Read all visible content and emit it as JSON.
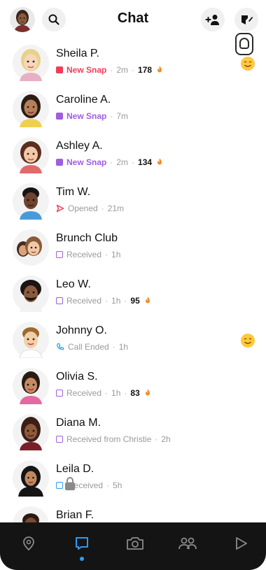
{
  "header": {
    "title": "Chat",
    "icons": [
      "bitmoji-avatar",
      "search-icon",
      "add-friend-icon",
      "new-chat-icon"
    ]
  },
  "colors": {
    "new_snap_red": "#f23c57",
    "new_snap_purple": "#a05ddf",
    "chat_blue": "#2ba0f0",
    "nav_bg": "#141414",
    "active_blue": "#2f9bf0"
  },
  "chats": [
    {
      "name": "Sheila P.",
      "status": "New Snap",
      "time": "2m",
      "streak": "178",
      "icon": "new-snap-red",
      "emoji": true
    },
    {
      "name": "Caroline A.",
      "status": "New Snap",
      "time": "7m",
      "streak": "",
      "icon": "new-snap-purple",
      "emoji": false
    },
    {
      "name": "Ashley A.",
      "status": "New Snap",
      "time": "2m",
      "streak": "134",
      "icon": "new-snap-purple",
      "emoji": false
    },
    {
      "name": "Tim W.",
      "status": "Opened",
      "time": "21m",
      "streak": "",
      "icon": "opened-red",
      "emoji": false
    },
    {
      "name": "Brunch Club",
      "status": "Received",
      "time": "1h",
      "streak": "",
      "icon": "received-purple",
      "emoji": false
    },
    {
      "name": "Leo W.",
      "status": "Received",
      "time": "1h",
      "streak": "95",
      "icon": "received-purple",
      "emoji": false
    },
    {
      "name": "Johnny O.",
      "status": "Call Ended",
      "time": "1h",
      "streak": "",
      "icon": "call-blue",
      "emoji": true
    },
    {
      "name": "Olivia S.",
      "status": "Received",
      "time": "1h",
      "streak": "83",
      "icon": "received-purple",
      "emoji": false
    },
    {
      "name": "Diana M.",
      "status": "Received from Christie",
      "time": "2h",
      "streak": "",
      "icon": "received-purple",
      "emoji": false
    },
    {
      "name": "Leila D.",
      "status": "Received",
      "time": "5h",
      "streak": "",
      "icon": "received-blue",
      "emoji": false
    },
    {
      "name": "Brian F.",
      "status": "",
      "time": "",
      "streak": "",
      "icon": "",
      "emoji": false
    }
  ],
  "nav": {
    "items": [
      "map-icon",
      "chat-icon",
      "camera-icon",
      "friends-icon",
      "stories-icon"
    ],
    "active": "chat-icon"
  }
}
